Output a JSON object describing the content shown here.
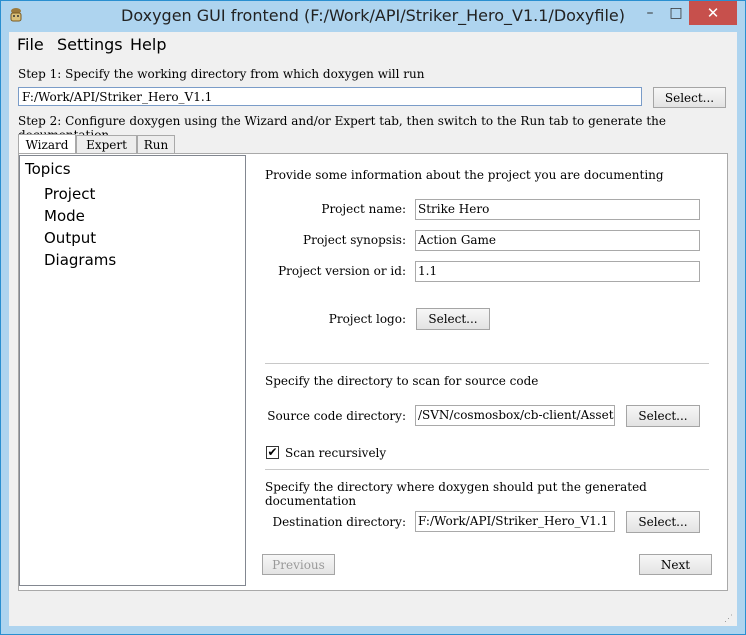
{
  "window": {
    "title": "Doxygen GUI frontend (F:/Work/API/Striker_Hero_V1.1/Doxyfile)"
  },
  "window_controls": {
    "minimize": "–",
    "maximize": "□",
    "close": "✕"
  },
  "menu": [
    "File",
    "Settings",
    "Help"
  ],
  "step1": {
    "label": "Step 1: Specify the working directory from which doxygen will run",
    "value": "F:/Work/API/Striker_Hero_V1.1",
    "select_label": "Select..."
  },
  "step2": {
    "label": "Step 2: Configure doxygen using the Wizard and/or Expert tab, then switch to the Run tab to generate the documentation"
  },
  "tabs": [
    "Wizard",
    "Expert",
    "Run"
  ],
  "topics": {
    "header": "Topics",
    "items": [
      "Project",
      "Mode",
      "Output",
      "Diagrams"
    ]
  },
  "project": {
    "intro": "Provide some information about the project you are documenting",
    "name_label": "Project name:",
    "name_value": "Strike Hero",
    "synopsis_label": "Project synopsis:",
    "synopsis_value": "Action Game",
    "version_label": "Project version or id:",
    "version_value": "1.1",
    "logo_label": "Project logo:",
    "logo_button": "Select..."
  },
  "source": {
    "intro": "Specify the directory to scan for source code",
    "dir_label": "Source code directory:",
    "dir_value": "/SVN/cosmosbox/cb-client/Assets",
    "select_label": "Select...",
    "scan_label": "Scan recursively",
    "scan_checked": "✔"
  },
  "dest": {
    "intro": "Specify the directory where doxygen should put the generated documentation",
    "dir_label": "Destination directory:",
    "dir_value": "F:/Work/API/Striker_Hero_V1.1",
    "select_label": "Select..."
  },
  "nav": {
    "previous": "Previous",
    "next": "Next"
  },
  "colors": {
    "title_bar": "#aed4ef",
    "close_button": "#c7504c",
    "input_border": "#7a9cc8"
  }
}
